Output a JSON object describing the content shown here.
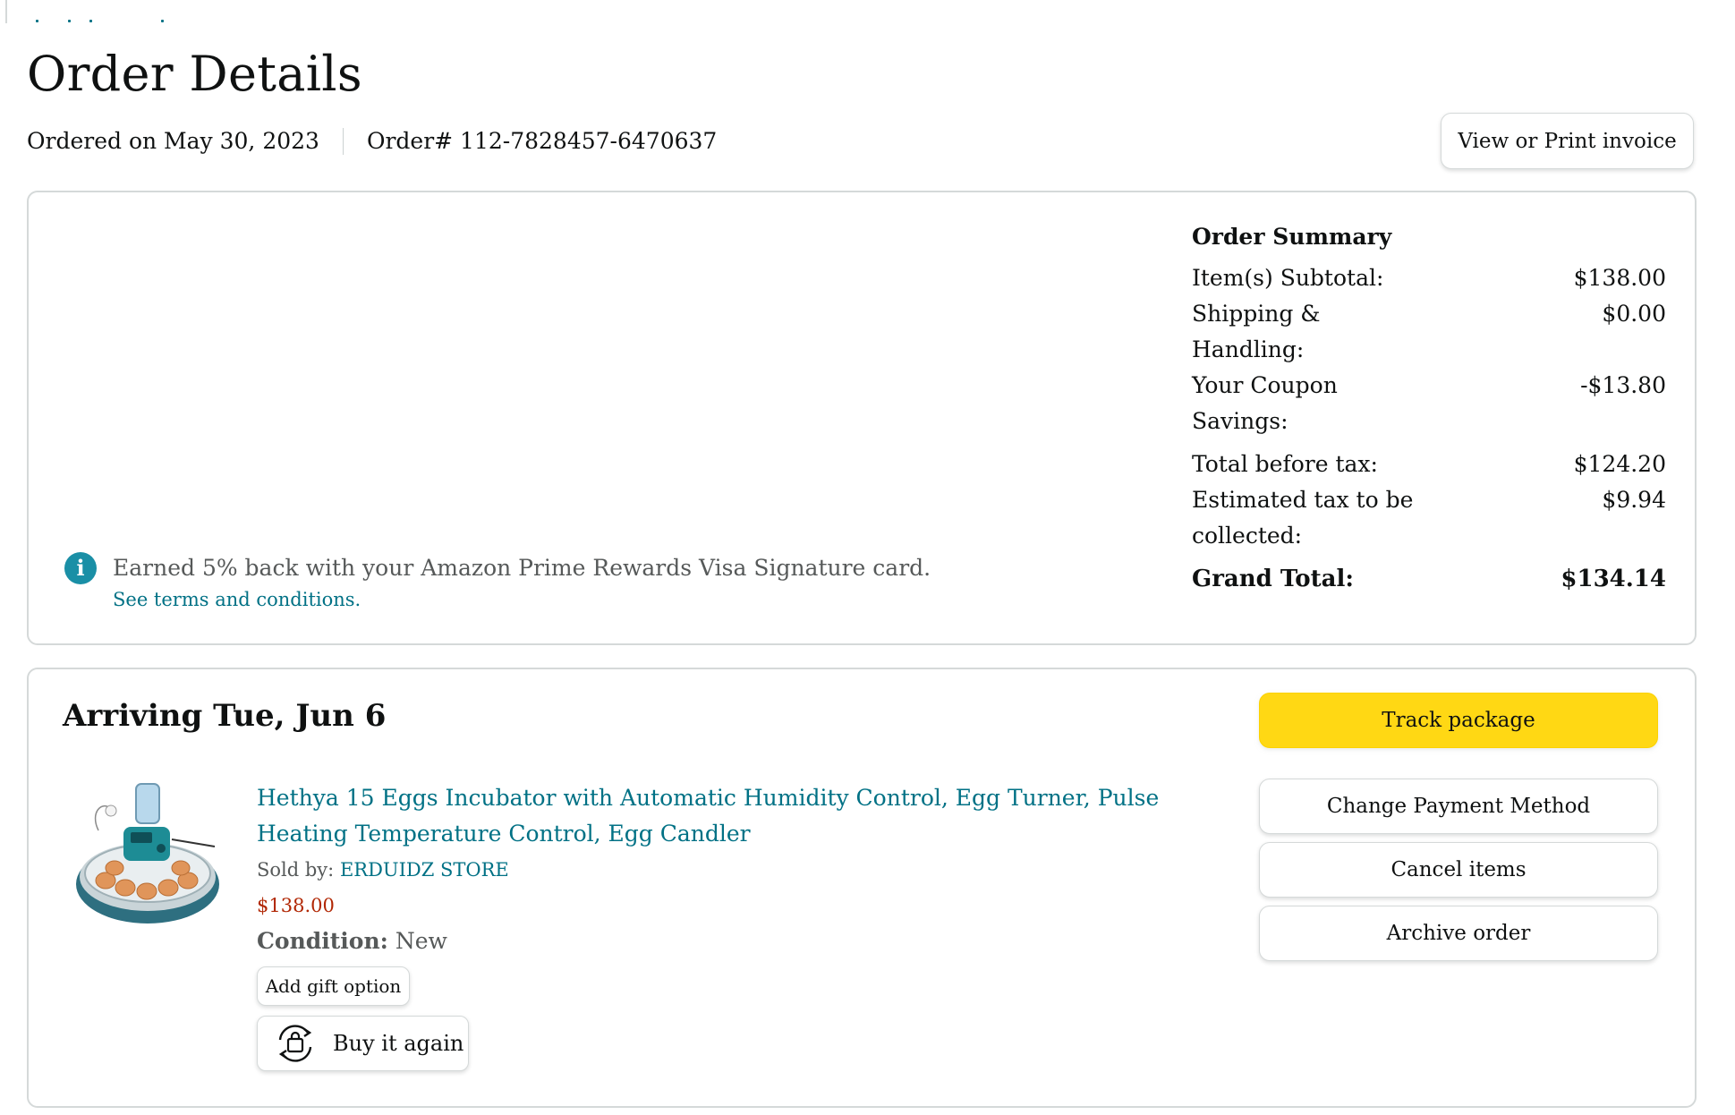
{
  "page": {
    "title": "Order Details",
    "ordered_on": "Ordered on May 30, 2023",
    "order_number": "Order# 112-7828457-6470637",
    "invoice_button": "View or Print invoice"
  },
  "order_summary": {
    "heading": "Order Summary",
    "rows": [
      {
        "label": "Item(s) Subtotal:",
        "value": "$138.00"
      },
      {
        "label": "Shipping & Handling:",
        "value": "$0.00"
      },
      {
        "label": "Your Coupon Savings:",
        "value": "-$13.80"
      },
      {
        "label": "Total before tax:",
        "value": "$124.20"
      },
      {
        "label": "Estimated tax to be collected:",
        "value": "$9.94"
      }
    ],
    "grand_total": {
      "label": "Grand Total:",
      "value": "$134.14"
    }
  },
  "rewards": {
    "icon": "info-icon",
    "message": "Earned 5% back with your Amazon Prime Rewards Visa Signature card.",
    "link": "See terms and conditions."
  },
  "shipment": {
    "arriving": "Arriving Tue, Jun 6",
    "item": {
      "title": "Hethya 15 Eggs Incubator with Automatic Humidity Control, Egg Turner, Pulse Heating Temperature Control, Egg Candler",
      "sold_by_label": "Sold by:",
      "seller": "ERDUIDZ STORE",
      "price": "$138.00",
      "condition_label": "Condition:",
      "condition": "New",
      "gift_button": "Add gift option",
      "buy_again_button": "Buy it again"
    },
    "actions": {
      "track": "Track package",
      "change_payment": "Change Payment Method",
      "cancel": "Cancel items",
      "archive": "Archive order"
    }
  },
  "colors": {
    "link": "#007185",
    "price": "#b12704",
    "track_button": "#ffd814",
    "info_icon": "#1a8fa6",
    "border": "#d5d9d9"
  }
}
